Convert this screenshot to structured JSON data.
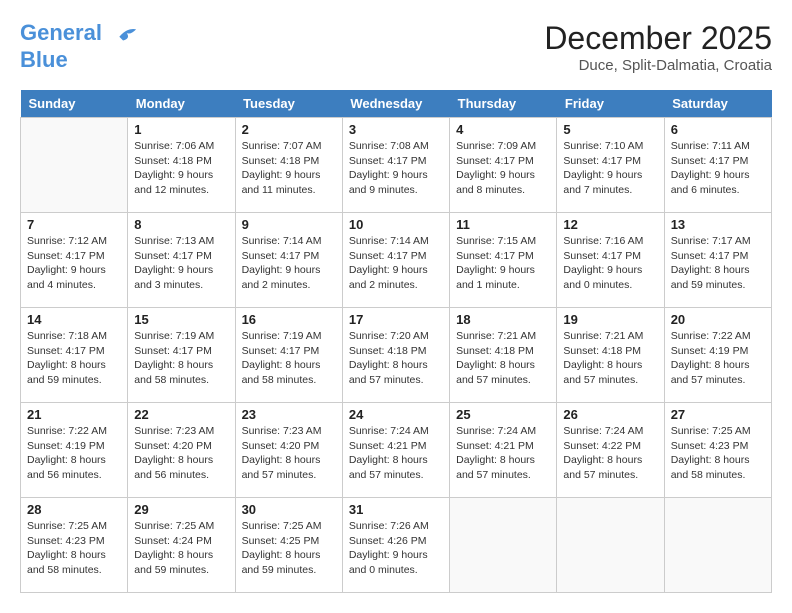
{
  "header": {
    "logo_line1": "General",
    "logo_line2": "Blue",
    "month": "December 2025",
    "location": "Duce, Split-Dalmatia, Croatia"
  },
  "weekdays": [
    "Sunday",
    "Monday",
    "Tuesday",
    "Wednesday",
    "Thursday",
    "Friday",
    "Saturday"
  ],
  "weeks": [
    [
      {
        "day": "",
        "info": ""
      },
      {
        "day": "1",
        "info": "Sunrise: 7:06 AM\nSunset: 4:18 PM\nDaylight: 9 hours\nand 12 minutes."
      },
      {
        "day": "2",
        "info": "Sunrise: 7:07 AM\nSunset: 4:18 PM\nDaylight: 9 hours\nand 11 minutes."
      },
      {
        "day": "3",
        "info": "Sunrise: 7:08 AM\nSunset: 4:17 PM\nDaylight: 9 hours\nand 9 minutes."
      },
      {
        "day": "4",
        "info": "Sunrise: 7:09 AM\nSunset: 4:17 PM\nDaylight: 9 hours\nand 8 minutes."
      },
      {
        "day": "5",
        "info": "Sunrise: 7:10 AM\nSunset: 4:17 PM\nDaylight: 9 hours\nand 7 minutes."
      },
      {
        "day": "6",
        "info": "Sunrise: 7:11 AM\nSunset: 4:17 PM\nDaylight: 9 hours\nand 6 minutes."
      }
    ],
    [
      {
        "day": "7",
        "info": "Sunrise: 7:12 AM\nSunset: 4:17 PM\nDaylight: 9 hours\nand 4 minutes."
      },
      {
        "day": "8",
        "info": "Sunrise: 7:13 AM\nSunset: 4:17 PM\nDaylight: 9 hours\nand 3 minutes."
      },
      {
        "day": "9",
        "info": "Sunrise: 7:14 AM\nSunset: 4:17 PM\nDaylight: 9 hours\nand 2 minutes."
      },
      {
        "day": "10",
        "info": "Sunrise: 7:14 AM\nSunset: 4:17 PM\nDaylight: 9 hours\nand 2 minutes."
      },
      {
        "day": "11",
        "info": "Sunrise: 7:15 AM\nSunset: 4:17 PM\nDaylight: 9 hours\nand 1 minute."
      },
      {
        "day": "12",
        "info": "Sunrise: 7:16 AM\nSunset: 4:17 PM\nDaylight: 9 hours\nand 0 minutes."
      },
      {
        "day": "13",
        "info": "Sunrise: 7:17 AM\nSunset: 4:17 PM\nDaylight: 8 hours\nand 59 minutes."
      }
    ],
    [
      {
        "day": "14",
        "info": "Sunrise: 7:18 AM\nSunset: 4:17 PM\nDaylight: 8 hours\nand 59 minutes."
      },
      {
        "day": "15",
        "info": "Sunrise: 7:19 AM\nSunset: 4:17 PM\nDaylight: 8 hours\nand 58 minutes."
      },
      {
        "day": "16",
        "info": "Sunrise: 7:19 AM\nSunset: 4:17 PM\nDaylight: 8 hours\nand 58 minutes."
      },
      {
        "day": "17",
        "info": "Sunrise: 7:20 AM\nSunset: 4:18 PM\nDaylight: 8 hours\nand 57 minutes."
      },
      {
        "day": "18",
        "info": "Sunrise: 7:21 AM\nSunset: 4:18 PM\nDaylight: 8 hours\nand 57 minutes."
      },
      {
        "day": "19",
        "info": "Sunrise: 7:21 AM\nSunset: 4:18 PM\nDaylight: 8 hours\nand 57 minutes."
      },
      {
        "day": "20",
        "info": "Sunrise: 7:22 AM\nSunset: 4:19 PM\nDaylight: 8 hours\nand 57 minutes."
      }
    ],
    [
      {
        "day": "21",
        "info": "Sunrise: 7:22 AM\nSunset: 4:19 PM\nDaylight: 8 hours\nand 56 minutes."
      },
      {
        "day": "22",
        "info": "Sunrise: 7:23 AM\nSunset: 4:20 PM\nDaylight: 8 hours\nand 56 minutes."
      },
      {
        "day": "23",
        "info": "Sunrise: 7:23 AM\nSunset: 4:20 PM\nDaylight: 8 hours\nand 57 minutes."
      },
      {
        "day": "24",
        "info": "Sunrise: 7:24 AM\nSunset: 4:21 PM\nDaylight: 8 hours\nand 57 minutes."
      },
      {
        "day": "25",
        "info": "Sunrise: 7:24 AM\nSunset: 4:21 PM\nDaylight: 8 hours\nand 57 minutes."
      },
      {
        "day": "26",
        "info": "Sunrise: 7:24 AM\nSunset: 4:22 PM\nDaylight: 8 hours\nand 57 minutes."
      },
      {
        "day": "27",
        "info": "Sunrise: 7:25 AM\nSunset: 4:23 PM\nDaylight: 8 hours\nand 58 minutes."
      }
    ],
    [
      {
        "day": "28",
        "info": "Sunrise: 7:25 AM\nSunset: 4:23 PM\nDaylight: 8 hours\nand 58 minutes."
      },
      {
        "day": "29",
        "info": "Sunrise: 7:25 AM\nSunset: 4:24 PM\nDaylight: 8 hours\nand 59 minutes."
      },
      {
        "day": "30",
        "info": "Sunrise: 7:25 AM\nSunset: 4:25 PM\nDaylight: 8 hours\nand 59 minutes."
      },
      {
        "day": "31",
        "info": "Sunrise: 7:26 AM\nSunset: 4:26 PM\nDaylight: 9 hours\nand 0 minutes."
      },
      {
        "day": "",
        "info": ""
      },
      {
        "day": "",
        "info": ""
      },
      {
        "day": "",
        "info": ""
      }
    ]
  ]
}
